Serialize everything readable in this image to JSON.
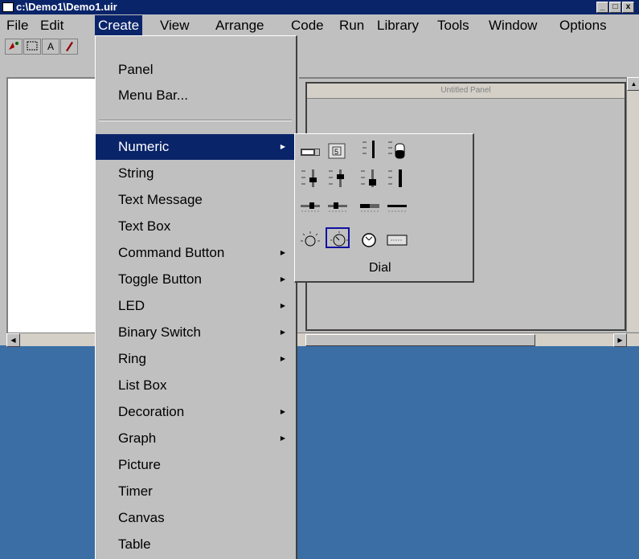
{
  "window": {
    "title": "c:\\Demo1\\Demo1.uir",
    "buttons": {
      "minimize": "_",
      "maximize": "□",
      "close": "x"
    }
  },
  "menubar": {
    "items": [
      "File",
      "Edit",
      "Create",
      "View",
      "Arrange",
      "Code",
      "Run",
      "Library",
      "Tools",
      "Window",
      "Options"
    ],
    "active": "Create"
  },
  "toolbar": {
    "icons": [
      "operate-tool-icon",
      "select-tool-icon",
      "label-tool-icon",
      "color-tool-icon"
    ],
    "label_tool_glyph": "A"
  },
  "panel": {
    "title": "Untitled Panel"
  },
  "create_menu": {
    "items": [
      {
        "label": "Panel",
        "submenu": false
      },
      {
        "label": "Menu Bar...",
        "submenu": false
      },
      {
        "label": "Numeric",
        "submenu": true,
        "highlighted": true
      },
      {
        "label": "String",
        "submenu": false
      },
      {
        "label": "Text Message",
        "submenu": false
      },
      {
        "label": "Text Box",
        "submenu": false
      },
      {
        "label": "Command Button",
        "submenu": true
      },
      {
        "label": "Toggle Button",
        "submenu": true
      },
      {
        "label": "LED",
        "submenu": true
      },
      {
        "label": "Binary Switch",
        "submenu": true
      },
      {
        "label": "Ring",
        "submenu": true
      },
      {
        "label": "List Box",
        "submenu": false
      },
      {
        "label": "Decoration",
        "submenu": true
      },
      {
        "label": "Graph",
        "submenu": true
      },
      {
        "label": "Picture",
        "submenu": false
      },
      {
        "label": "Timer",
        "submenu": false
      },
      {
        "label": "Canvas",
        "submenu": false
      },
      {
        "label": "Table",
        "submenu": false
      }
    ]
  },
  "numeric_submenu": {
    "rows": [
      [
        "numeric-control-icon",
        "numeric-box-icon",
        "slider-thin-icon",
        "tank-icon"
      ],
      [
        "vertical-slider-icon",
        "vertical-slider-icon",
        "vertical-slider-icon",
        "vertical-slider-icon"
      ],
      [
        "horizontal-slider-icon",
        "horizontal-slider-icon",
        "horizontal-slider-icon",
        "horizontal-slider-icon"
      ],
      [
        "knob-icon",
        "dial-icon",
        "gauge-icon",
        "meter-display-icon"
      ]
    ],
    "selected": "dial-icon",
    "tooltip": "Dial"
  },
  "colors": {
    "desktop": "#3a6ea5",
    "face": "#c0c0c0",
    "highlight": "#0a246a"
  }
}
